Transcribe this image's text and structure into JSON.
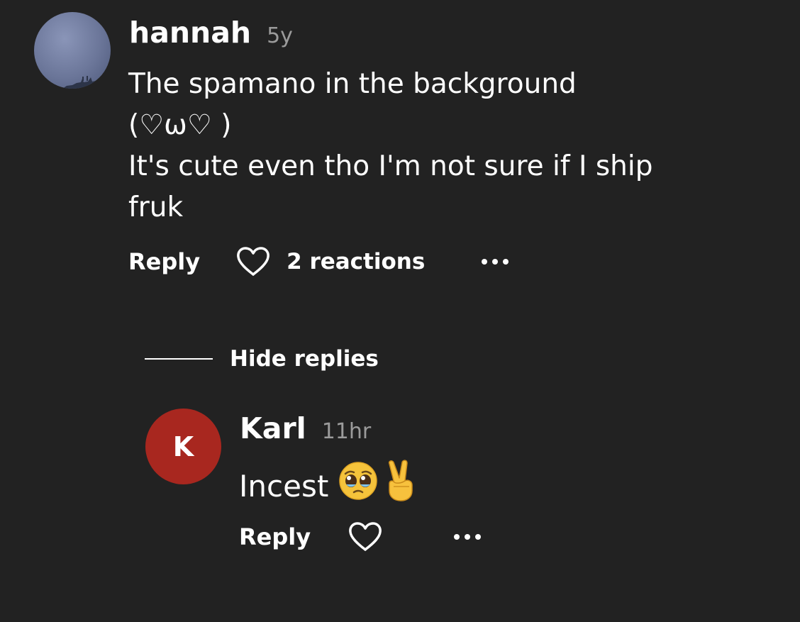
{
  "comment": {
    "username": "hannah",
    "timestamp": "5y",
    "body_lines": [
      "The spamano in the background",
      "(♡ω♡ )",
      "It's cute even tho I'm not sure if I ship",
      "fruk"
    ],
    "actions": {
      "reply_label": "Reply",
      "reactions_label": "2 reactions"
    }
  },
  "thread": {
    "hide_replies_label": "Hide replies"
  },
  "reply": {
    "avatar_letter": "K",
    "avatar_color": "#a8271f",
    "username": "Karl",
    "timestamp": "11hr",
    "body_text": "Incest",
    "emojis": [
      "pleading-face-icon",
      "victory-hand-icon"
    ],
    "actions": {
      "reply_label": "Reply"
    }
  },
  "colors": {
    "background": "#222222",
    "text": "#ffffff",
    "timestamp": "#9b9b9b"
  }
}
